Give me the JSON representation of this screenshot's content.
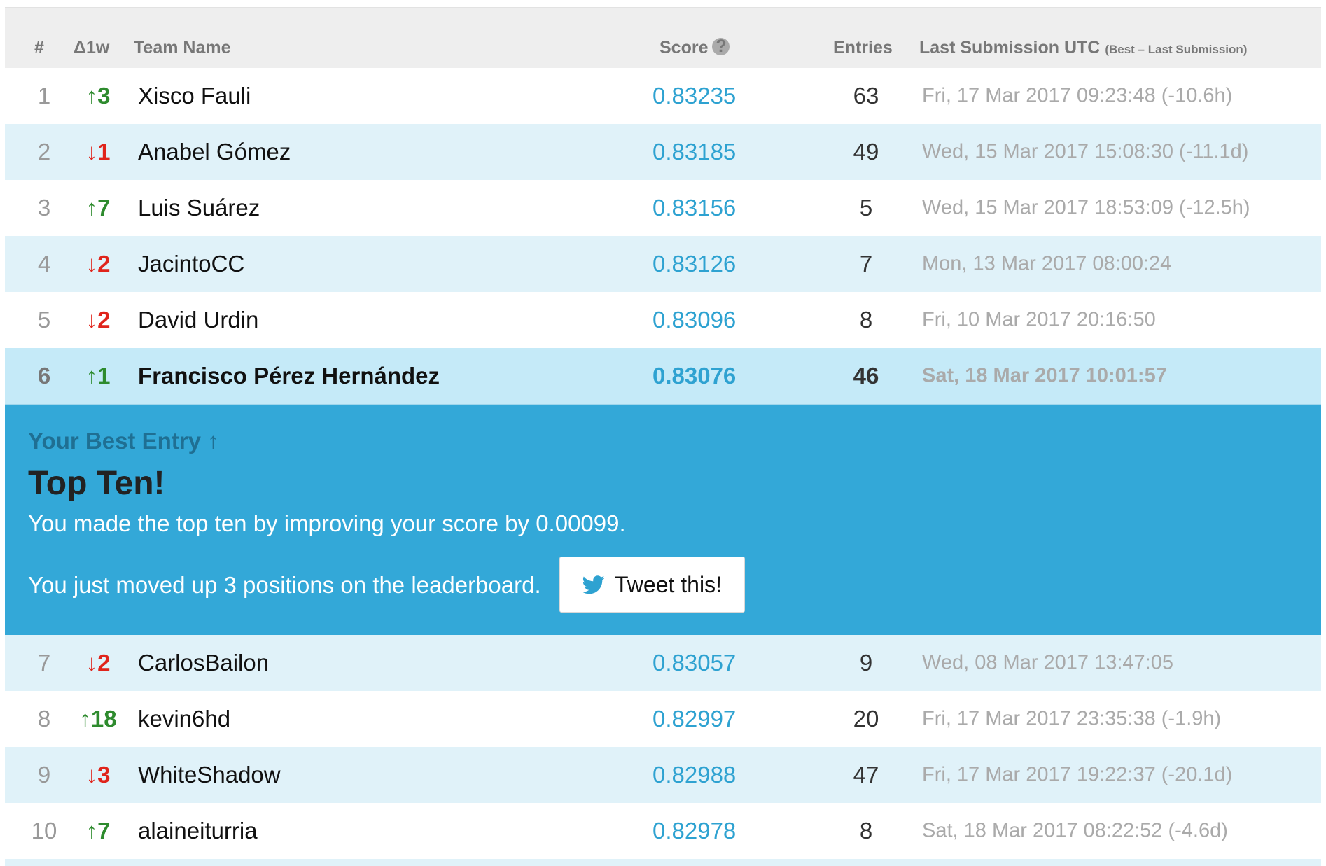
{
  "header": {
    "rank": "#",
    "delta": "Δ1w",
    "team": "Team Name",
    "score": "Score",
    "help_icon": "?",
    "entries": "Entries",
    "last": "Last Submission UTC",
    "last_note": "(Best – Last Submission)"
  },
  "rows_top": [
    {
      "rank": "1",
      "arrow": "↑",
      "delta": "3",
      "dir": "up",
      "team": "Xisco Fauli",
      "score": "0.83235",
      "entries": "63",
      "last": "Fri, 17 Mar 2017 09:23:48 (-10.6h)"
    },
    {
      "rank": "2",
      "arrow": "↓",
      "delta": "1",
      "dir": "down",
      "team": "Anabel Gómez",
      "score": "0.83185",
      "entries": "49",
      "last": "Wed, 15 Mar 2017 15:08:30 (-11.1d)"
    },
    {
      "rank": "3",
      "arrow": "↑",
      "delta": "7",
      "dir": "up",
      "team": "Luis Suárez",
      "score": "0.83156",
      "entries": "5",
      "last": "Wed, 15 Mar 2017 18:53:09 (-12.5h)"
    },
    {
      "rank": "4",
      "arrow": "↓",
      "delta": "2",
      "dir": "down",
      "team": "JacintoCC",
      "score": "0.83126",
      "entries": "7",
      "last": "Mon, 13 Mar 2017 08:00:24"
    },
    {
      "rank": "5",
      "arrow": "↓",
      "delta": "2",
      "dir": "down",
      "team": "David Urdin",
      "score": "0.83096",
      "entries": "8",
      "last": "Fri, 10 Mar 2017 20:16:50"
    }
  ],
  "my_row": {
    "rank": "6",
    "arrow": "↑",
    "delta": "1",
    "dir": "up",
    "team": "Francisco Pérez Hernández",
    "score": "0.83076",
    "entries": "46",
    "last": "Sat, 18 Mar 2017 10:01:57"
  },
  "banner": {
    "kicker": "Your Best Entry ↑",
    "title": "Top Ten!",
    "message1": "You made the top ten by improving your score by 0.00099.",
    "message2": "You just moved up 3 positions on the leaderboard.",
    "tweet_label": "Tweet this!",
    "twitter_icon": "twitter-bird-icon"
  },
  "rows_bottom": [
    {
      "rank": "7",
      "arrow": "↓",
      "delta": "2",
      "dir": "down",
      "team": "CarlosBailon",
      "score": "0.83057",
      "entries": "9",
      "last": "Wed, 08 Mar 2017 13:47:05"
    },
    {
      "rank": "8",
      "arrow": "↑",
      "delta": "18",
      "dir": "up",
      "team": "kevin6hd",
      "score": "0.82997",
      "entries": "20",
      "last": "Fri, 17 Mar 2017 23:35:38 (-1.9h)"
    },
    {
      "rank": "9",
      "arrow": "↓",
      "delta": "3",
      "dir": "down",
      "team": "WhiteShadow",
      "score": "0.82988",
      "entries": "47",
      "last": "Fri, 17 Mar 2017 19:22:37 (-20.1d)"
    },
    {
      "rank": "10",
      "arrow": "↑",
      "delta": "7",
      "dir": "up",
      "team": "alaineiturria",
      "score": "0.82978",
      "entries": "8",
      "last": "Sat, 18 Mar 2017 08:22:52 (-4.6d)"
    }
  ],
  "colors": {
    "accent": "#33a8d8",
    "score": "#2ea2d1",
    "up": "#2e8b2e",
    "down": "#e0241b",
    "row_alt": "#e0f2f9",
    "highlight": "#c5eaf8"
  }
}
